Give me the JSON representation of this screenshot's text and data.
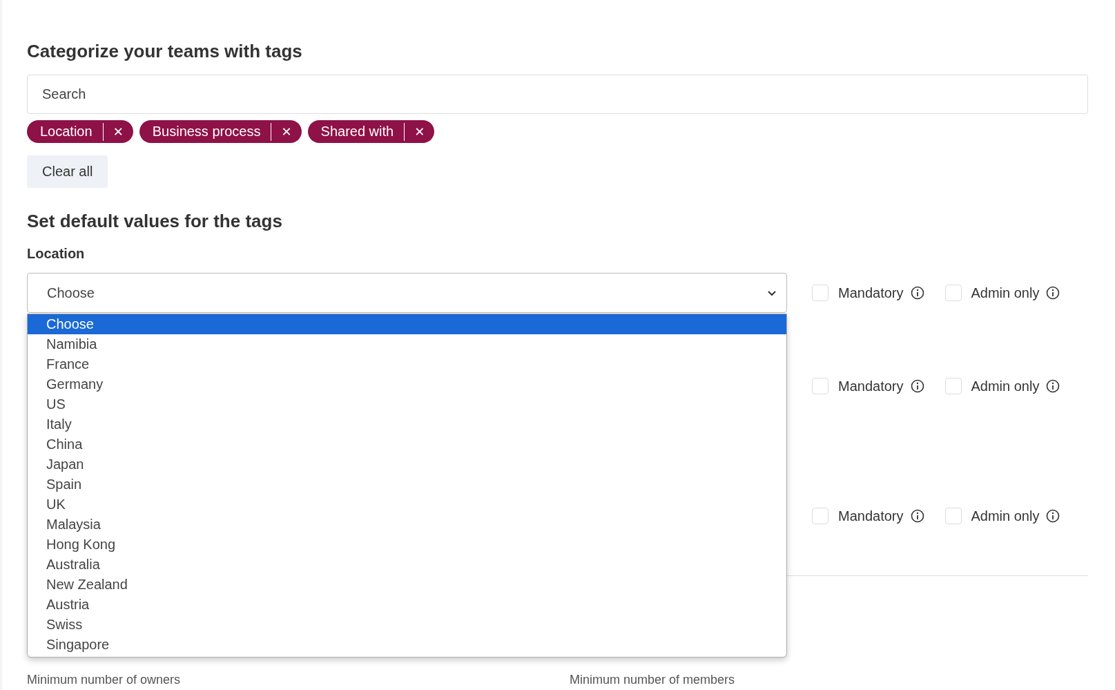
{
  "title": "Categorize your teams with tags",
  "search": {
    "placeholder": "Search"
  },
  "tags": [
    {
      "label": "Location",
      "remove": "✕"
    },
    {
      "label": "Business process",
      "remove": "✕"
    },
    {
      "label": "Shared with",
      "remove": "✕"
    }
  ],
  "clear_button": "Clear all",
  "defaults_title": "Set default values for the tags",
  "tag_settings": [
    {
      "label": "Location",
      "select": {
        "value": "Choose",
        "expanded": true,
        "options": [
          {
            "label": "Choose",
            "selected": true
          },
          {
            "label": "Namibia",
            "selected": false
          },
          {
            "label": "France",
            "selected": false
          },
          {
            "label": "Germany",
            "selected": false
          },
          {
            "label": "US",
            "selected": false
          },
          {
            "label": "Italy",
            "selected": false
          },
          {
            "label": "China",
            "selected": false
          },
          {
            "label": "Japan",
            "selected": false
          },
          {
            "label": "Spain",
            "selected": false
          },
          {
            "label": "UK",
            "selected": false
          },
          {
            "label": "Malaysia",
            "selected": false
          },
          {
            "label": "Hong Kong",
            "selected": false
          },
          {
            "label": "Australia",
            "selected": false
          },
          {
            "label": "New Zealand",
            "selected": false
          },
          {
            "label": "Austria",
            "selected": false
          },
          {
            "label": "Swiss",
            "selected": false
          },
          {
            "label": "Singapore",
            "selected": false
          }
        ]
      },
      "mandatory": {
        "label": "Mandatory",
        "checked": false
      },
      "admin_only": {
        "label": "Admin only",
        "checked": false
      }
    },
    {
      "mandatory": {
        "label": "Mandatory",
        "checked": false
      },
      "admin_only": {
        "label": "Admin only",
        "checked": false
      }
    },
    {
      "mandatory": {
        "label": "Mandatory",
        "checked": false
      },
      "admin_only": {
        "label": "Admin only",
        "checked": false
      }
    }
  ],
  "bottom_fields": [
    {
      "label": "Minimum number of owners"
    },
    {
      "label": "Minimum number of members"
    }
  ]
}
